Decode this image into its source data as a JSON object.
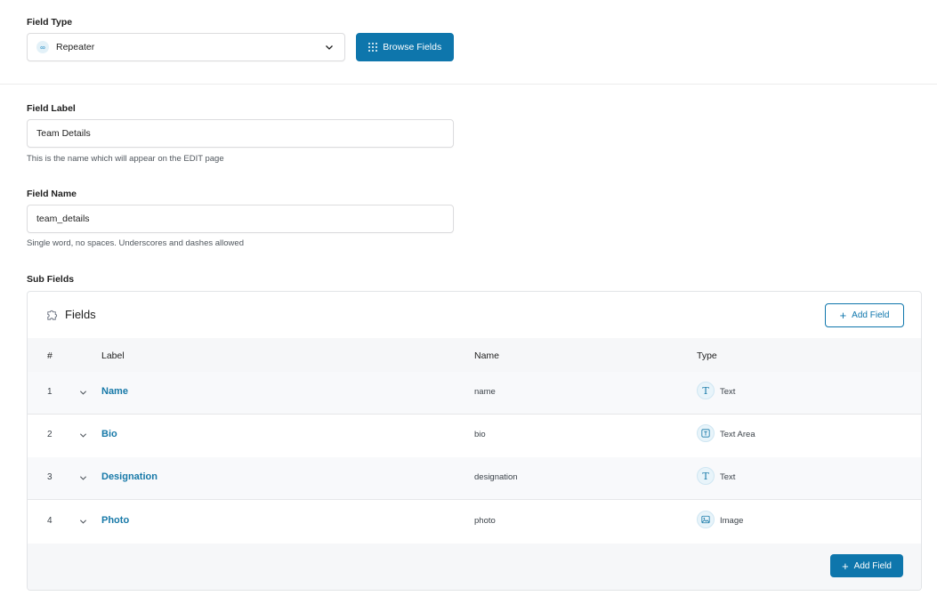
{
  "field_type": {
    "label": "Field Type",
    "selected_value": "Repeater",
    "selected_icon": "infinity-icon",
    "browse_button": "Browse Fields"
  },
  "field_label": {
    "label": "Field Label",
    "value": "Team Details",
    "help": "This is the name which will appear on the EDIT page"
  },
  "field_name": {
    "label": "Field Name",
    "value": "team_details",
    "help": "Single word, no spaces. Underscores and dashes allowed"
  },
  "sub_fields": {
    "label": "Sub Fields",
    "panel_title": "Fields",
    "add_field_top": "Add Field",
    "add_field_bottom": "Add Field",
    "columns": [
      "#",
      "Label",
      "Name",
      "Type"
    ],
    "rows": [
      {
        "num": "1",
        "label": "Name",
        "name": "name",
        "type": "Text",
        "type_icon": "text-type-icon"
      },
      {
        "num": "2",
        "label": "Bio",
        "name": "bio",
        "type": "Text Area",
        "type_icon": "textarea-type-icon"
      },
      {
        "num": "3",
        "label": "Designation",
        "name": "designation",
        "type": "Text",
        "type_icon": "text-type-icon"
      },
      {
        "num": "4",
        "label": "Photo",
        "name": "photo",
        "type": "Image",
        "type_icon": "image-type-icon"
      }
    ]
  },
  "colors": {
    "primary": "#0e76ac",
    "link": "#1779a8",
    "border": "#dcdcde"
  }
}
